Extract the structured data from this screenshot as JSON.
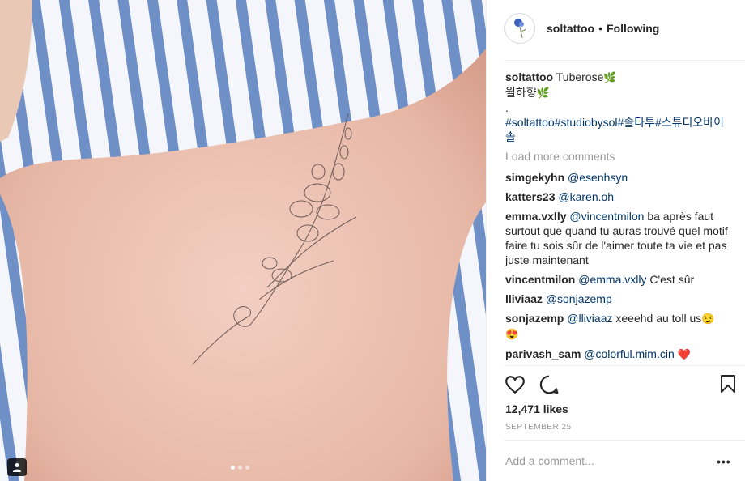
{
  "post": {
    "username": "soltattoo",
    "separator": "•",
    "follow_status": "Following"
  },
  "caption": {
    "username": "soltattoo",
    "text": "Tuberose",
    "line2": "월하향",
    "line3": ".",
    "hashtags": "#soltattoo#studiobysol#솔타투#스튜디오바이솔"
  },
  "load_more": "Load more comments",
  "comments": [
    {
      "user": "simgekyhn",
      "mention": "@esenhsyn",
      "text": ""
    },
    {
      "user": "katters23",
      "mention": "@karen.oh",
      "text": ""
    },
    {
      "user": "emma.vxlly",
      "mention": "@vincentmilon",
      "text": "ba après faut surtout que quand tu auras trouvé quel motif faire tu sois sûr de l'aimer toute ta vie et pas juste maintenant"
    },
    {
      "user": "vincentmilon",
      "mention": "@emma.vxlly",
      "text": "C'est sûr"
    },
    {
      "user": "lliviaaz",
      "mention": "@sonjazemp",
      "text": ""
    },
    {
      "user": "sonjazemp",
      "mention": "@lliviaaz",
      "text": "xeeehd au toll us"
    },
    {
      "user": "parivash_sam",
      "mention": "@colorful.mim.cin",
      "text": ""
    }
  ],
  "likes": "12,471 likes",
  "date": "SEPTEMBER 25",
  "add_comment_placeholder": "Add a comment...",
  "more_options": "•••",
  "icons": {
    "leaf": "leaf-emoji",
    "smile": "smiling-emoji",
    "heart_eyes": "heart-eyes-emoji",
    "heart": "red-heart-emoji",
    "like": "heart-outline-icon",
    "comment": "comment-bubble-icon",
    "save": "bookmark-icon",
    "user_tag": "user-tag-icon"
  },
  "colors": {
    "mention": "#003569",
    "muted": "#999999",
    "text": "#262626"
  }
}
